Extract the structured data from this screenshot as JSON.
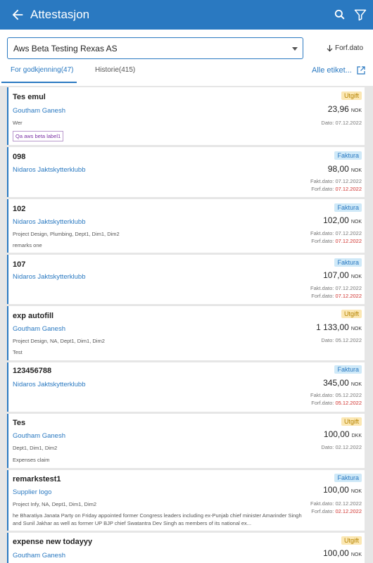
{
  "appbar": {
    "title": "Attestasjon"
  },
  "company_select": {
    "value": "Aws Beta Testing Rexas AS"
  },
  "sort": {
    "label": "Forf.dato"
  },
  "tabs": [
    {
      "label": "For godkjenning(47)"
    },
    {
      "label": "Historie(415)"
    }
  ],
  "alle_label": "Alle etiket...",
  "cards": [
    {
      "name": "Tes emul",
      "badge": "Utgift",
      "party": "Goutham Ganesh",
      "amount": "23,96",
      "currency": "NOK",
      "line1": "Wer",
      "date_label": "Dato:",
      "date": "07.12.2022",
      "tag": "Qa aws beta label1"
    },
    {
      "name": "098",
      "badge": "Faktura",
      "party": "Nidaros Jaktskytterklubb",
      "amount": "98,00",
      "currency": "NOK",
      "fakt_label": "Fakt.dato:",
      "fakt": "07.12.2022",
      "forf_label": "Forf.dato:",
      "forf": "07.12.2022"
    },
    {
      "name": "102",
      "badge": "Faktura",
      "party": "Nidaros Jaktskytterklubb",
      "amount": "102,00",
      "currency": "NOK",
      "line1": "Project Design, Plumbing, Dept1, Dim1, Dim2",
      "line2": "remarks one",
      "fakt_label": "Fakt.dato:",
      "fakt": "07.12.2022",
      "forf_label": "Forf.dato:",
      "forf": "07.12.2022"
    },
    {
      "name": "107",
      "badge": "Faktura",
      "party": "Nidaros Jaktskytterklubb",
      "amount": "107,00",
      "currency": "NOK",
      "fakt_label": "Fakt.dato:",
      "fakt": "07.12.2022",
      "forf_label": "Forf.dato:",
      "forf": "07.12.2022"
    },
    {
      "name": "exp autofill",
      "badge": "Utgift",
      "party": "Goutham Ganesh",
      "amount": "1 133,00",
      "currency": "NOK",
      "line1": "Project Design, NA, Dept1, Dim1, Dim2",
      "line2": "Test",
      "date_label": "Dato:",
      "date": "05.12.2022"
    },
    {
      "name": "123456788",
      "badge": "Faktura",
      "party": "Nidaros Jaktskytterklubb",
      "amount": "345,00",
      "currency": "NOK",
      "fakt_label": "Fakt.dato:",
      "fakt": "05.12.2022",
      "forf_label": "Forf.dato:",
      "forf": "05.12.2022"
    },
    {
      "name": "Tes",
      "badge": "Utgift",
      "party": "Goutham Ganesh",
      "amount": "100,00",
      "currency": "DKK",
      "line1": "Dept1, Dim1, Dim2",
      "line2": "Expenses claim",
      "date_label": "Dato:",
      "date": "02.12.2022"
    },
    {
      "name": "remarkstest1",
      "badge": "Faktura",
      "party": "Supplier logo",
      "amount": "100,00",
      "currency": "NOK",
      "line1": "Project Infy, NA, Dept1, Dim1, Dim2",
      "line2": "he Bharatiya Janata Party on Friday appointed former Congress leaders including ex-Punjab chief minister Amarinder Singh and Sunil Jakhar as well as former UP BJP chief Swatantra Dev Singh as members of its national ex...",
      "fakt_label": "Fakt.dato:",
      "fakt": "02.12.2022",
      "forf_label": "Forf.dato:",
      "forf": "02.12.2022"
    },
    {
      "name": "expense new todayyy",
      "badge": "Utgift",
      "party": "Goutham Ganesh",
      "amount": "100,00",
      "currency": "NOK"
    }
  ]
}
